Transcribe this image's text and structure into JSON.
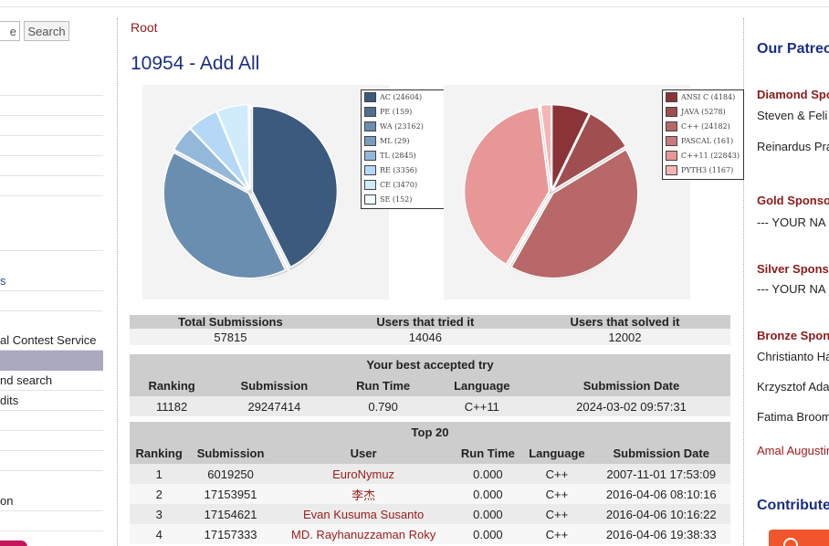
{
  "sidebar": {
    "search_value": "e",
    "search_button": "Search",
    "items": [
      {
        "label": "",
        "style": "plain"
      },
      {
        "label": "",
        "style": "plain"
      },
      {
        "label": "",
        "style": "plain"
      },
      {
        "label": "",
        "style": "plain"
      },
      {
        "label": "",
        "style": "plain"
      },
      {
        "label": "",
        "style": "plain"
      },
      {
        "label": "",
        "style": "plain"
      },
      {
        "label": "s",
        "style": "blue"
      },
      {
        "label": "",
        "style": "plain"
      },
      {
        "label": "al Contest Service",
        "style": "plain"
      },
      {
        "label": "",
        "style": "highlight"
      },
      {
        "label": "nd search",
        "style": "plain"
      },
      {
        "label": "dits",
        "style": "plain"
      },
      {
        "label": "",
        "style": "plain"
      },
      {
        "label": "",
        "style": "plain"
      },
      {
        "label": "",
        "style": "plain"
      },
      {
        "label": "on",
        "style": "plain"
      },
      {
        "label": "",
        "style": "plain"
      }
    ]
  },
  "main": {
    "breadcrumb": "Root",
    "title": "10954 - Add All"
  },
  "chart_data": [
    {
      "type": "pie",
      "legend_position": "right",
      "slices": [
        {
          "label": "AC",
          "value": 24604,
          "color": "#3b5a7d"
        },
        {
          "label": "PE",
          "value": 159,
          "color": "#4f6f90"
        },
        {
          "label": "WA",
          "value": 23162,
          "color": "#6a8eb0"
        },
        {
          "label": "ML",
          "value": 29,
          "color": "#7a9dbd"
        },
        {
          "label": "TL",
          "value": 2845,
          "color": "#93b8d9"
        },
        {
          "label": "RE",
          "value": 3356,
          "color": "#b5d8f6"
        },
        {
          "label": "CE",
          "value": 3470,
          "color": "#d0ecfb"
        },
        {
          "label": "SE",
          "value": 152,
          "color": "#f1faff"
        }
      ],
      "legend": [
        "AC (24604)",
        "PE (159)",
        "WA (23162)",
        "ML (29)",
        "TL (2845)",
        "RE (3356)",
        "CE (3470)",
        "SE (152)"
      ]
    },
    {
      "type": "pie",
      "legend_position": "right",
      "slices": [
        {
          "label": "ANSI C",
          "value": 4184,
          "color": "#8a3437"
        },
        {
          "label": "JAVA",
          "value": 5278,
          "color": "#a04e50"
        },
        {
          "label": "C++",
          "value": 24182,
          "color": "#b86868"
        },
        {
          "label": "PASCAL",
          "value": 161,
          "color": "#c97b7b"
        },
        {
          "label": "C++11",
          "value": 22843,
          "color": "#e89797"
        },
        {
          "label": "PYTH3",
          "value": 1167,
          "color": "#f4b6b4"
        }
      ],
      "legend": [
        "ANSI C (4184)",
        "JAVA (5278)",
        "C++ (24182)",
        "PASCAL (161)",
        "C++11 (22843)",
        "PYTH3 (1167)"
      ]
    }
  ],
  "stats": {
    "headers": [
      "Total Submissions",
      "Users that tried it",
      "Users that solved it"
    ],
    "values": [
      "57815",
      "14046",
      "12002"
    ]
  },
  "best": {
    "title": "Your best accepted try",
    "headers": [
      "Ranking",
      "Submission",
      "Run Time",
      "Language",
      "Submission Date"
    ],
    "row": [
      "11182",
      "29247414",
      "0.790",
      "C++11",
      "2024-03-02 09:57:31"
    ]
  },
  "top20": {
    "title": "Top 20",
    "headers": [
      "Ranking",
      "Submission",
      "User",
      "Run Time",
      "Language",
      "Submission Date"
    ],
    "rows": [
      [
        "1",
        "6019250",
        "EuroNymuz",
        "0.000",
        "C++",
        "2007-11-01 17:53:09"
      ],
      [
        "2",
        "17153951",
        "李杰",
        "0.000",
        "C++",
        "2016-04-06 08:10:16"
      ],
      [
        "3",
        "17154621",
        "Evan Kusuma Susanto",
        "0.000",
        "C++",
        "2016-04-06 10:16:22"
      ],
      [
        "4",
        "17157333",
        "MD. Rayhanuzzaman Roky",
        "0.000",
        "C++",
        "2016-04-06 19:38:33"
      ]
    ]
  },
  "right": {
    "patrons_heading": "Our Patreo",
    "diamond_label": "Diamond Spo",
    "diamond_names": [
      "Steven & Feli",
      "Reinardus Pra"
    ],
    "gold_label": "Gold Sponso",
    "gold_names": [
      "--- YOUR NA"
    ],
    "silver_label": "Silver Spons",
    "silver_names": [
      "--- YOUR NA"
    ],
    "bronze_label": "Bronze Spon",
    "bronze_names": [
      "Christianto Ha",
      "Krzysztof Ada",
      "Fatima Broom"
    ],
    "extra_name": "Amal Augustin",
    "contributors_heading": "Contribute"
  }
}
